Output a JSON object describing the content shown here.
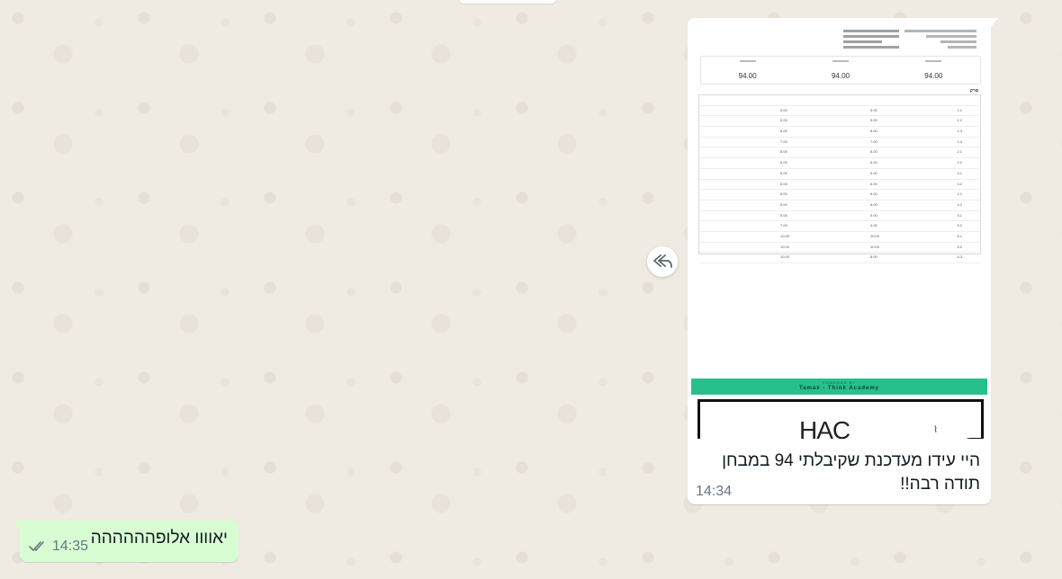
{
  "colors": {
    "wallpaper": "#efeae2",
    "incoming_bubble": "#ffffff",
    "outgoing_bubble": "#d9fdd3",
    "timestamp": "#667781",
    "read_ticks": "#53bdeb",
    "receipt_band": "#27c08a"
  },
  "incoming_message": {
    "image_receipt": {
      "scores": [
        "94.00",
        "94.00",
        "94.00"
      ],
      "section_label": "פרק",
      "rows": [
        [
          "5.00",
          "5.00",
          "1.1"
        ],
        [
          "5.00",
          "5.00",
          "1.2"
        ],
        [
          "8.00",
          "8.00",
          "1.3"
        ],
        [
          "7.00",
          "7.00",
          "1.4"
        ],
        [
          "8.00",
          "8.00",
          "2.1"
        ],
        [
          "6.00",
          "6.00",
          "2.2"
        ],
        [
          "5.00",
          "5.00",
          "3.1"
        ],
        [
          "6.00",
          "6.00",
          "3.2"
        ],
        [
          "6.00",
          "6.00",
          "4.1"
        ],
        [
          "8.00",
          "8.00",
          "4.2"
        ],
        [
          "5.00",
          "5.00",
          "5.1"
        ],
        [
          "7.00",
          "4.00",
          "5.2"
        ],
        [
          "10.00",
          "10.00",
          "6.1"
        ],
        [
          "10.00",
          "10.00",
          "6.2"
        ],
        [
          "10.00",
          "8.00",
          "6.3"
        ]
      ],
      "powered_by": "POWERED BY",
      "powered_name": "Tamax - Think Academy",
      "brand_text": "HAC"
    },
    "text_line1": "היי עידו מעדכנת שקיבלתי 94 במבחן",
    "text_line2": "תודה רבה!!",
    "time": "14:34"
  },
  "reply_button": {
    "icon": "reply-all-icon"
  },
  "outgoing_message": {
    "text": "יאוווו אלופהההההה",
    "time": "14:35",
    "status_icon": "double-check-icon"
  }
}
